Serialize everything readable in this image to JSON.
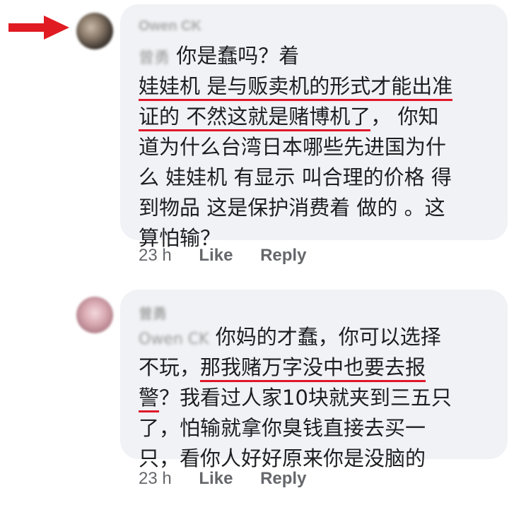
{
  "comment1": {
    "author_name": "Owen CK",
    "mention": "曾勇",
    "line1": "你是蠢吗？着",
    "line2": "娃娃机 是与贩卖机的形式才能出准",
    "line3a": "证的 不然这就是赌博机了",
    "line3b": "， 你知",
    "line4": "道为什么台湾日本哪些先进国为什",
    "line5": "么 娃娃机 有显示 叫合理的价格 得",
    "line6": "到物品 这是保护消费着 做的 。这",
    "line7": "算怕输？",
    "time": "23 h",
    "like": "Like",
    "reply": "Reply"
  },
  "comment2": {
    "author_name": "曾勇",
    "mention": "Owen CK",
    "line1": "你妈的才蠢，你可以选择",
    "line2a": "不玩，",
    "line2b": "那我赌万字没中也要去报",
    "line3a": "警",
    "line3b": "？我看过人家10块就夹到三五只",
    "line4": "了，怕输就拿你臭钱直接去买一",
    "line5": "只，看你人好好原来你是没脑的",
    "time": "23 h",
    "like": "Like",
    "reply": "Reply"
  },
  "colors": {
    "bubble": "#f0f2f5",
    "underline": "#e0172b",
    "arrow": "#e01b22",
    "meta": "#65676b"
  }
}
